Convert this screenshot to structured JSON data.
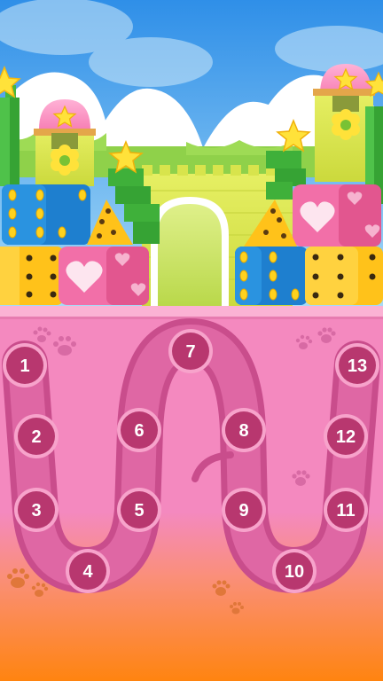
{
  "screen": "level-select",
  "colors": {
    "sky_top": "#2f8fe8",
    "sky_bottom": "#9fd4f6",
    "board_pink": "#f18ac0",
    "board_orange": "#ff8a12",
    "path": "#d95c9b",
    "node_fill": "#b8376f",
    "node_ring": "#f7a3cb",
    "castle_yellow": "#dfe95a",
    "die_blue": "#1e8ad6",
    "die_yellow": "#ffc21a",
    "die_pink": "#f26fa8"
  },
  "scene": {
    "decorations": [
      "cloud-icon",
      "star-icon",
      "flower-icon",
      "heart-die-icon",
      "dot-die-icon",
      "tree-icon",
      "castle-icon",
      "paw-print-icon"
    ]
  },
  "levels": [
    {
      "label": "1"
    },
    {
      "label": "2"
    },
    {
      "label": "3"
    },
    {
      "label": "4"
    },
    {
      "label": "5"
    },
    {
      "label": "6"
    },
    {
      "label": "7"
    },
    {
      "label": "8"
    },
    {
      "label": "9"
    },
    {
      "label": "10"
    },
    {
      "label": "11"
    },
    {
      "label": "12"
    },
    {
      "label": "13"
    }
  ]
}
